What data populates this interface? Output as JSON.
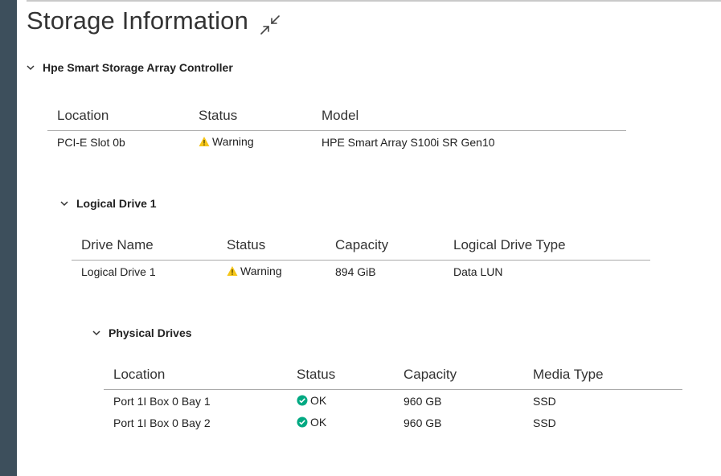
{
  "page": {
    "title": "Storage Information"
  },
  "controller": {
    "title": "Hpe Smart Storage Array Controller",
    "columns": [
      "Location",
      "Status",
      "Model"
    ],
    "rows": [
      {
        "location": "PCI-E Slot 0b",
        "status": "Warning",
        "model": "HPE Smart Array S100i SR Gen10"
      }
    ]
  },
  "logical_drive": {
    "title": "Logical Drive 1",
    "columns": [
      "Drive Name",
      "Status",
      "Capacity",
      "Logical Drive Type"
    ],
    "rows": [
      {
        "name": "Logical Drive 1",
        "status": "Warning",
        "capacity": "894 GiB",
        "type": "Data LUN"
      }
    ]
  },
  "physical_drives": {
    "title": "Physical Drives",
    "columns": [
      "Location",
      "Status",
      "Capacity",
      "Media Type"
    ],
    "rows": [
      {
        "location": "Port 1I Box 0 Bay 1",
        "status": "OK",
        "capacity": "960 GB",
        "media": "SSD"
      },
      {
        "location": "Port 1I Box 0 Bay 2",
        "status": "OK",
        "capacity": "960 GB",
        "media": "SSD"
      }
    ]
  },
  "colors": {
    "rail": "#3d4f5c",
    "warning": "#f5c518",
    "ok": "#01a982"
  },
  "icons": {
    "collapse": "collapse-arrows-icon",
    "warning": "warning-icon",
    "ok": "ok-check-icon",
    "chevron": "chevron-down-icon"
  }
}
